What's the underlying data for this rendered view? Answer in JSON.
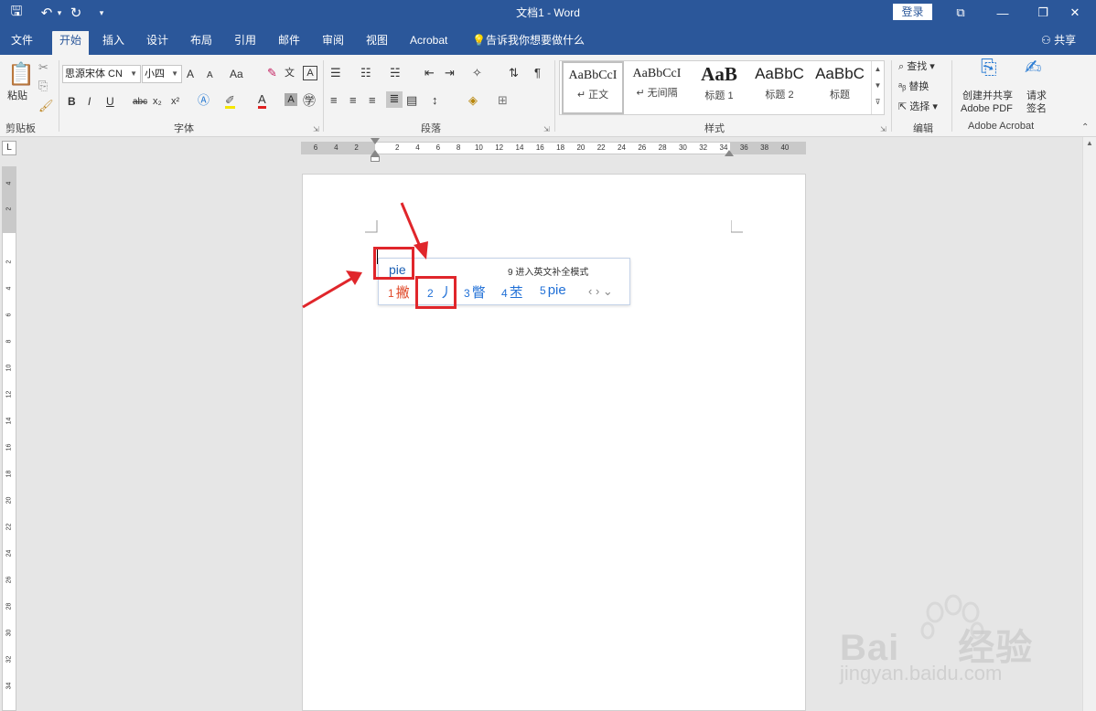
{
  "titlebar": {
    "title": "文档1  -  Word",
    "login": "登录",
    "qa_save": "🖫",
    "qa_undo": "↶",
    "qa_undo_arrow": "▾",
    "qa_redo": "↻",
    "qa_customize": "▾",
    "btn_restore_ribbon": "⧉",
    "btn_min": "—",
    "btn_max": "❐",
    "btn_close": "✕"
  },
  "tabs": {
    "file": "文件",
    "home": "开始",
    "insert": "插入",
    "design": "设计",
    "layout": "布局",
    "references": "引用",
    "mailings": "邮件",
    "review": "审阅",
    "view": "视图",
    "acrobat": "Acrobat",
    "tell_me": "告诉我你想要做什么",
    "share": "共享"
  },
  "ribbon": {
    "clipboard": {
      "paste": "粘贴",
      "label": "剪贴板"
    },
    "font": {
      "name": "思源宋体 CN",
      "size": "小四",
      "grow": "A",
      "shrink": "A",
      "case": "Aa",
      "bold": "B",
      "italic": "I",
      "underline": "U",
      "strike": "abc",
      "sub": "x₂",
      "sup": "x²",
      "color": "A",
      "label": "字体"
    },
    "paragraph": {
      "label": "段落"
    },
    "styles": {
      "items": [
        {
          "preview": "AaBbCcI",
          "name": "↵ 正文"
        },
        {
          "preview": "AaBbCcI",
          "name": "↵ 无间隔"
        },
        {
          "preview": "AaB",
          "name": "标题 1"
        },
        {
          "preview": "AaBbC",
          "name": "标题 2"
        },
        {
          "preview": "AaBbC",
          "name": "标题"
        }
      ],
      "label": "样式"
    },
    "editing": {
      "find": "查找",
      "replace": "替换",
      "select": "选择",
      "label": "编辑"
    },
    "acrobat": {
      "create": "创建并共享",
      "create2": "Adobe PDF",
      "sign": "请求",
      "sign2": "签名",
      "label": "Adobe Acrobat"
    }
  },
  "ruler": {
    "corner": "L",
    "h_numbers": [
      "6",
      "4",
      "2",
      "2",
      "4",
      "6",
      "8",
      "10",
      "12",
      "14",
      "16",
      "18",
      "20",
      "22",
      "24",
      "26",
      "28",
      "30",
      "32",
      "34",
      "36",
      "38",
      "40",
      "42"
    ],
    "v_numbers": [
      "4",
      "2",
      "2",
      "4",
      "6",
      "8",
      "10",
      "12",
      "14",
      "16",
      "18",
      "20",
      "22",
      "24",
      "26",
      "28",
      "30",
      "32",
      "34"
    ]
  },
  "ime": {
    "composition": "pie",
    "hint": "9 进入英文补全模式",
    "candidates": [
      {
        "n": "1",
        "text": "撇"
      },
      {
        "n": "2",
        "text": "丿"
      },
      {
        "n": "3",
        "text": "瞥"
      },
      {
        "n": "4",
        "text": "苤"
      },
      {
        "n": "5",
        "text": "pie"
      }
    ],
    "nav": "‹ › ⌄"
  },
  "watermark": {
    "line1": "Bai",
    "line1b": "经验",
    "line2": "jingyan.baidu.com"
  },
  "colors": {
    "accent": "#2b579a",
    "highlight": "#e0262b",
    "ime_blue": "#1f6fd6",
    "candidate_first": "#e04a2a"
  }
}
